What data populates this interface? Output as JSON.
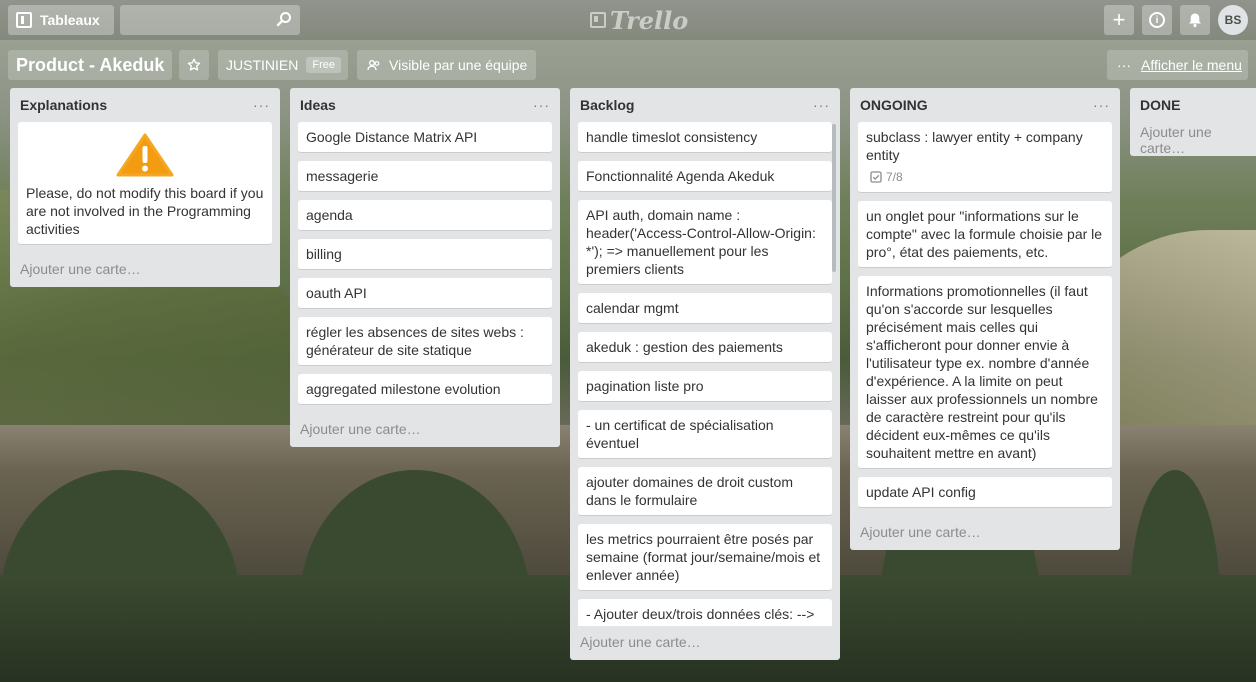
{
  "header": {
    "boards_label": "Tableaux",
    "search_placeholder": "",
    "logo_text": "Trello",
    "add_symbol": "+",
    "info_symbol": "i",
    "avatar_initials": "BS"
  },
  "board": {
    "title": "Product - Akeduk",
    "team": "JUSTINIEN",
    "team_badge": "Free",
    "visibility": "Visible par une équipe",
    "menu_label": "Afficher le menu",
    "menu_dots": "···"
  },
  "lists": [
    {
      "title": "Explanations",
      "menu": "···",
      "warning_text": "Please, do not modify this board if you are not involved in the Programming activities",
      "add_card": "Ajouter une carte…"
    },
    {
      "title": "Ideas",
      "menu": "···",
      "cards": [
        "Google Distance Matrix API",
        "messagerie",
        "agenda",
        "billing",
        "oauth API",
        "régler les absences de sites webs : générateur de site statique",
        "aggregated milestone evolution"
      ],
      "add_card": "Ajouter une carte…"
    },
    {
      "title": "Backlog",
      "menu": "···",
      "cards": [
        "handle timeslot consistency",
        "Fonctionnalité Agenda Akeduk",
        "API auth, domain name : header('Access-Control-Allow-Origin: *'); => manuellement pour les premiers clients",
        "calendar mgmt",
        "akeduk : gestion des paiements",
        "pagination liste pro",
        "- un certificat de spécialisation éventuel",
        "ajouter domaines de droit custom dans le formulaire",
        "les metrics pourraient être posés par semaine (format jour/semaine/mois et enlever année)",
        "- Ajouter deux/trois données clés: -->"
      ],
      "add_card": "Ajouter une carte…"
    },
    {
      "title": "ONGOING",
      "menu": "···",
      "cards": [
        "subclass : lawyer entity + company entity",
        "un onglet pour \"informations sur le compte\" avec la formule choisie par le pro°, état des paiements, etc.",
        "Informations promotionnelles (il faut qu'on s'accorde sur lesquelles précisément mais celles qui s'afficheront pour donner envie à l'utilisateur type ex. nombre d'année d'expérience. A la limite on peut laisser aux professionnels un nombre de caractère restreint pour qu'ils décident eux-mêmes ce qu'ils souhaitent mettre en avant)",
        "update API config"
      ],
      "checklist_badge": "7/8",
      "add_card": "Ajouter une carte…"
    },
    {
      "title": "DONE",
      "add_card": "Ajouter une carte…"
    }
  ]
}
